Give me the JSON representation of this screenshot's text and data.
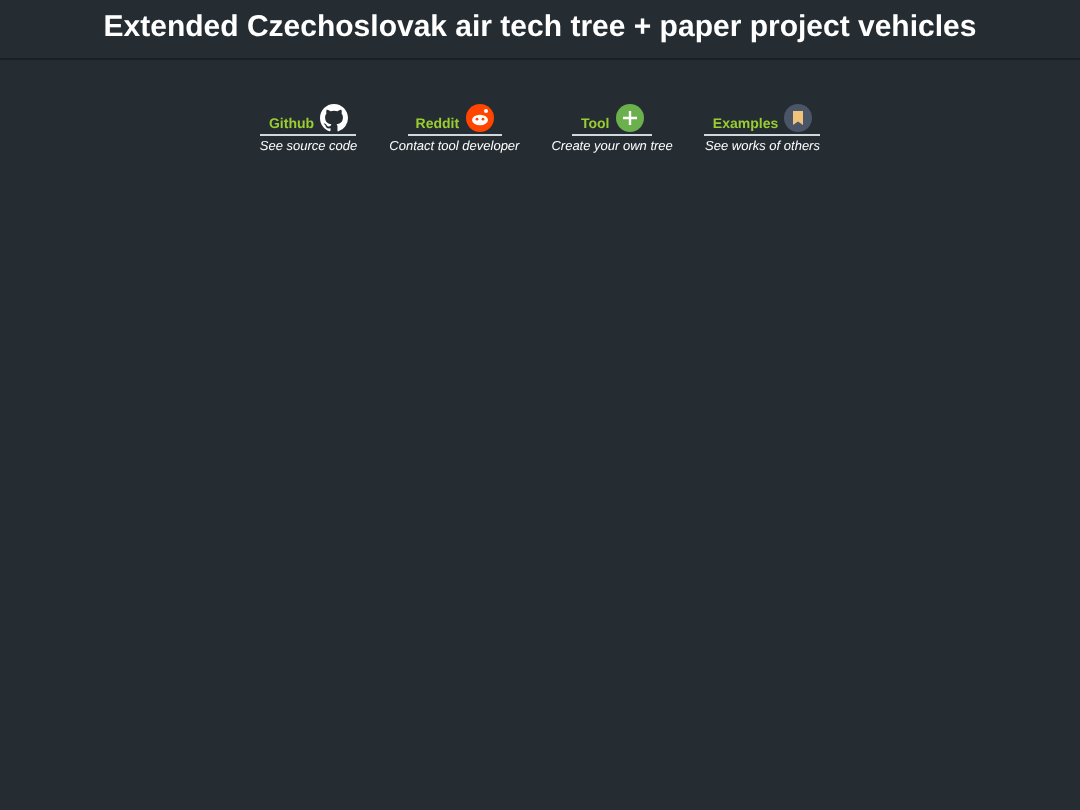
{
  "title": "Extended Czechoslovak air tech tree + paper project vehicles",
  "links": [
    {
      "kind": "github",
      "label": "Github",
      "caption": "See source code"
    },
    {
      "kind": "reddit",
      "label": "Reddit",
      "caption": "Contact tool developer"
    },
    {
      "kind": "tool",
      "label": "Tool",
      "caption": "Create your own tree"
    },
    {
      "kind": "examples",
      "label": "Examples",
      "caption": "See works of others"
    }
  ]
}
